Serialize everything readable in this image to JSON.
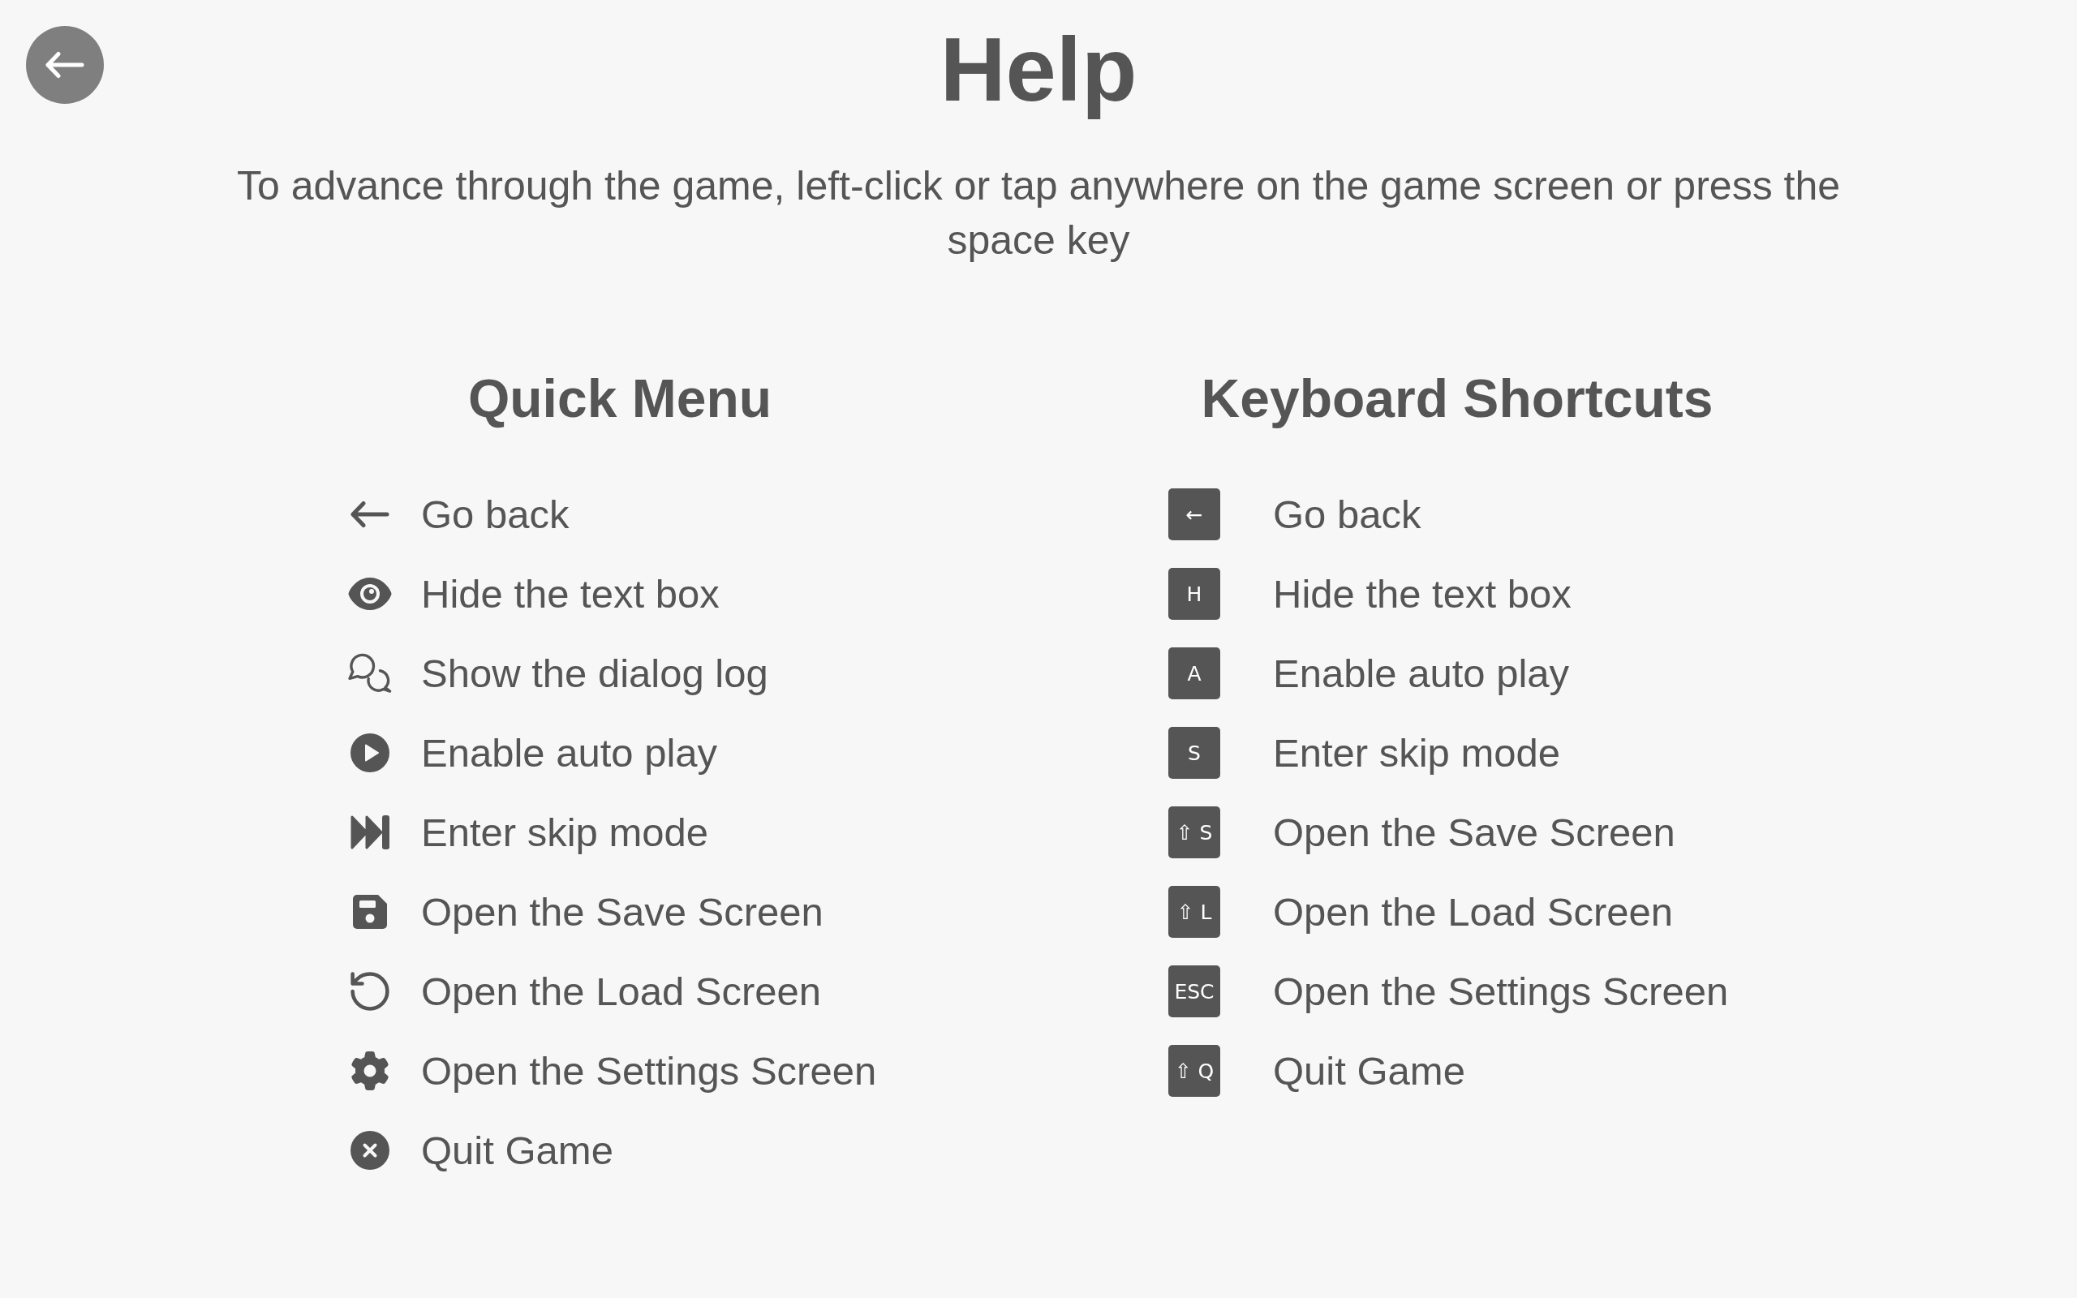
{
  "title": "Help",
  "instructions": "To advance through the game, left-click or tap anywhere on the game screen or press the space key",
  "quick_menu": {
    "heading": "Quick Menu",
    "items": [
      "Go back",
      "Hide the text box",
      "Show the dialog log",
      "Enable auto play",
      "Enter skip mode",
      "Open the Save Screen",
      "Open the Load Screen",
      "Open the Settings Screen",
      "Quit Game"
    ]
  },
  "keyboard_shortcuts": {
    "heading": "Keyboard Shortcuts",
    "items": [
      {
        "key": "←",
        "label": "Go back"
      },
      {
        "key": "H",
        "label": "Hide the text box"
      },
      {
        "key": "A",
        "label": "Enable auto play"
      },
      {
        "key": "S",
        "label": "Enter skip mode"
      },
      {
        "key": "⇧ S",
        "label": "Open the Save Screen"
      },
      {
        "key": "⇧ L",
        "label": "Open the Load Screen"
      },
      {
        "key": "ESC",
        "label": "Open the Settings Screen"
      },
      {
        "key": "⇧ Q",
        "label": "Quit Game"
      }
    ]
  }
}
